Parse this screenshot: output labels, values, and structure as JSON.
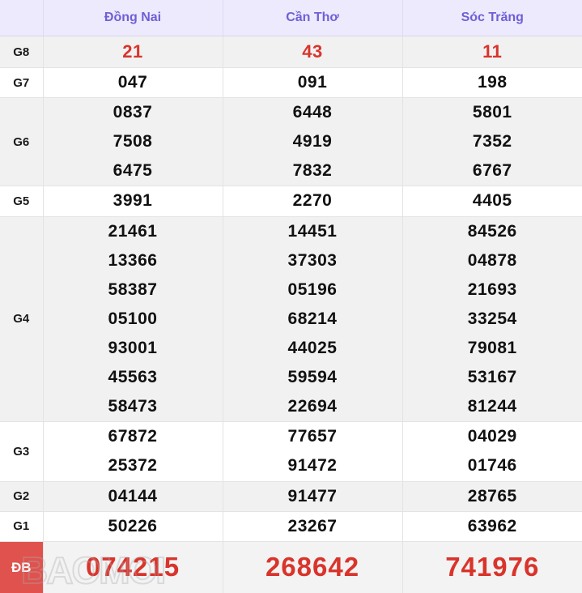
{
  "table": {
    "corner_label": "",
    "provinces": [
      "Đồng Nai",
      "Cần Thơ",
      "Sóc Trăng"
    ],
    "accent_header_bg": "#eceafc",
    "accent_header_text": "#6f5fd6",
    "special_red": "#d9342b",
    "special_label_bg": "#e0524d",
    "rows": [
      {
        "grade": "G8",
        "values": [
          [
            "21"
          ],
          [
            "43"
          ],
          [
            "11"
          ]
        ]
      },
      {
        "grade": "G7",
        "values": [
          [
            "047"
          ],
          [
            "091"
          ],
          [
            "198"
          ]
        ]
      },
      {
        "grade": "G6",
        "values": [
          [
            "0837",
            "7508",
            "6475"
          ],
          [
            "6448",
            "4919",
            "7832"
          ],
          [
            "5801",
            "7352",
            "6767"
          ]
        ]
      },
      {
        "grade": "G5",
        "values": [
          [
            "3991"
          ],
          [
            "2270"
          ],
          [
            "4405"
          ]
        ]
      },
      {
        "grade": "G4",
        "values": [
          [
            "21461",
            "13366",
            "58387",
            "05100",
            "93001",
            "45563",
            "58473"
          ],
          [
            "14451",
            "37303",
            "05196",
            "68214",
            "44025",
            "59594",
            "22694"
          ],
          [
            "84526",
            "04878",
            "21693",
            "33254",
            "79081",
            "53167",
            "81244"
          ]
        ]
      },
      {
        "grade": "G3",
        "values": [
          [
            "67872",
            "25372"
          ],
          [
            "77657",
            "91472"
          ],
          [
            "04029",
            "01746"
          ]
        ]
      },
      {
        "grade": "G2",
        "values": [
          [
            "04144"
          ],
          [
            "91477"
          ],
          [
            "28765"
          ]
        ]
      },
      {
        "grade": "G1",
        "values": [
          [
            "50226"
          ],
          [
            "23267"
          ],
          [
            "63962"
          ]
        ]
      },
      {
        "grade": "ĐB",
        "values": [
          [
            "074215"
          ],
          [
            "268642"
          ],
          [
            "741976"
          ]
        ]
      }
    ]
  },
  "watermark": {
    "text": "BAOMOI",
    "label_text": "ĐB"
  }
}
